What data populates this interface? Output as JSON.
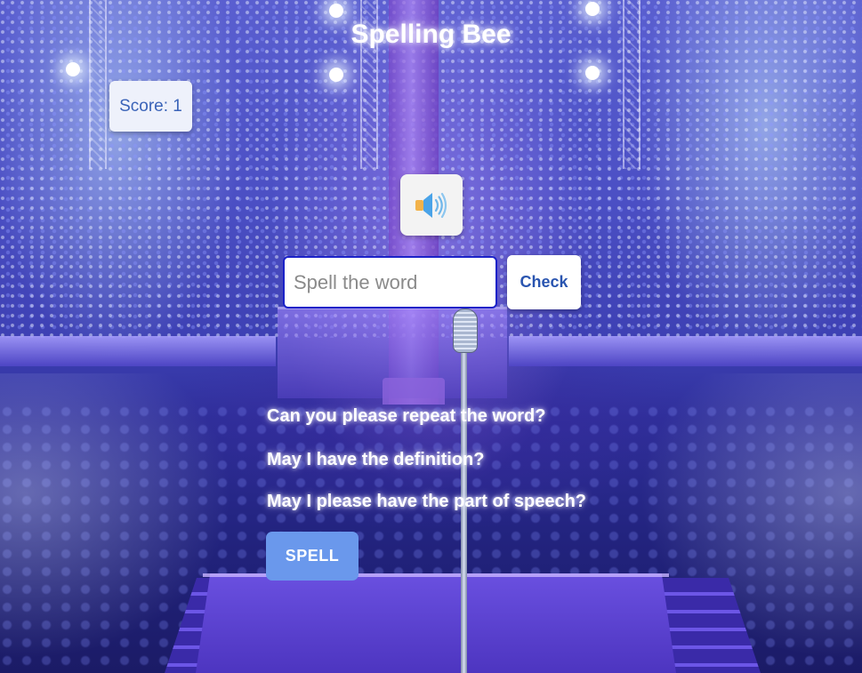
{
  "app": {
    "title": "Spelling Bee"
  },
  "score": {
    "text": "Score: 1"
  },
  "speaker": {
    "icon": "speaker-sound-icon",
    "colors": {
      "body": "#f2b24a",
      "cone": "#4aa3e8",
      "waves": "#6fb6ea"
    }
  },
  "answer": {
    "value": "",
    "placeholder": "Spell the word",
    "check_label": "Check"
  },
  "questions": [
    {
      "label": "Can you please repeat the word?"
    },
    {
      "label": "May I have the definition?"
    },
    {
      "label": "May I please have the part of speech?"
    }
  ],
  "spell_label": "SPELL",
  "theme": {
    "accent": "#6a98ec",
    "input_border": "#1b22c8",
    "score_text": "#3a63b8"
  }
}
